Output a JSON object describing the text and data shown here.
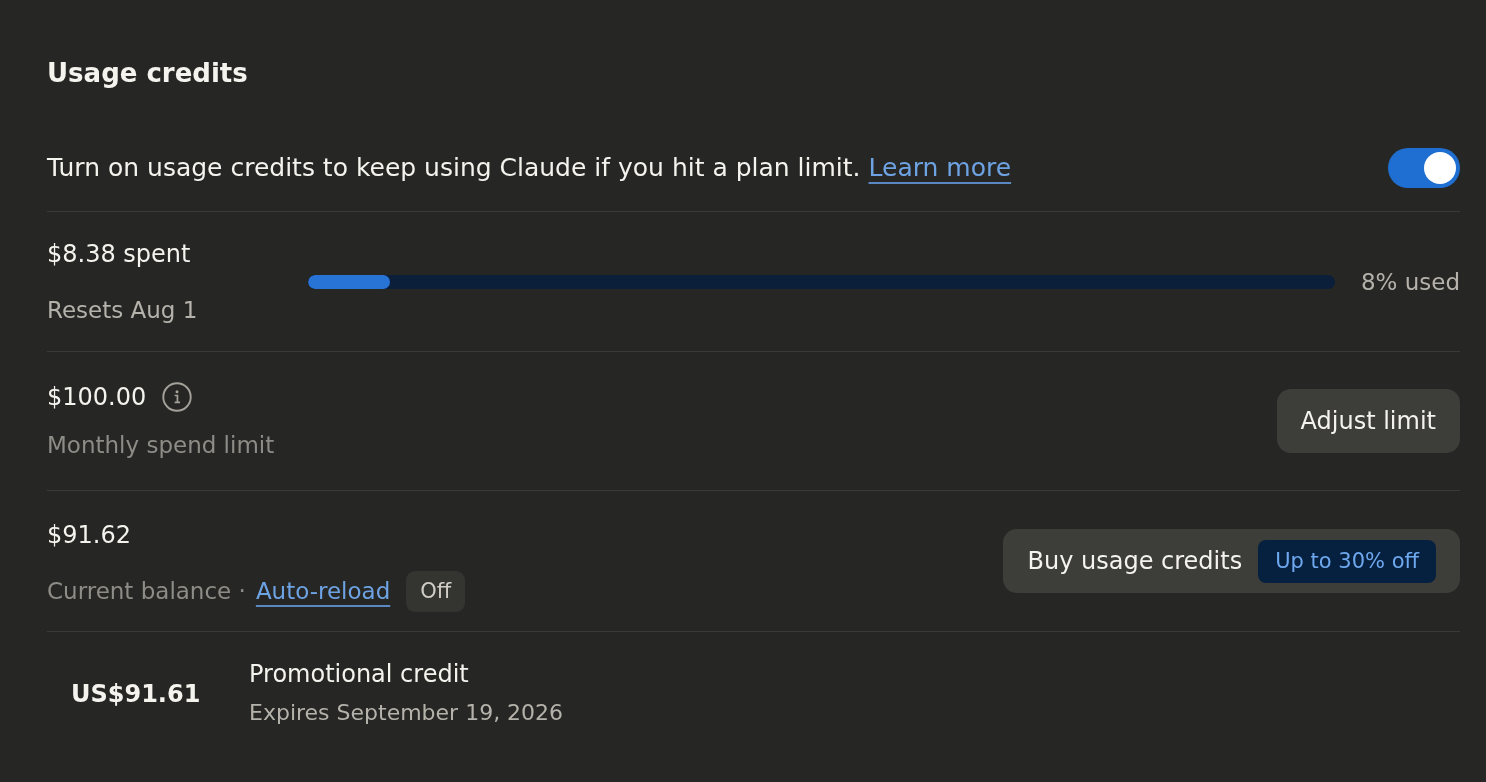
{
  "section": {
    "title": "Usage credits"
  },
  "toggle_row": {
    "description": "Turn on usage credits to keep using Claude if you hit a plan limit.",
    "link": "Learn more",
    "on": true
  },
  "spend": {
    "amount": "$8.38 spent",
    "resets": "Resets Aug 1",
    "level": 0.08,
    "reading": "8% used"
  },
  "limit": {
    "amount": "$100.00",
    "label": "Monthly spend limit",
    "button": "Adjust limit"
  },
  "balance": {
    "amount": "$91.62",
    "label": "Current balance ·",
    "link": "Auto-reload",
    "auto_reload_status": "Off",
    "button": "Buy usage credits",
    "badge": "Up to 30% off"
  },
  "credits": [
    {
      "amount": "US$91.61",
      "name": "Promotional credit",
      "expires": "Expires September 19, 2026"
    }
  ]
}
